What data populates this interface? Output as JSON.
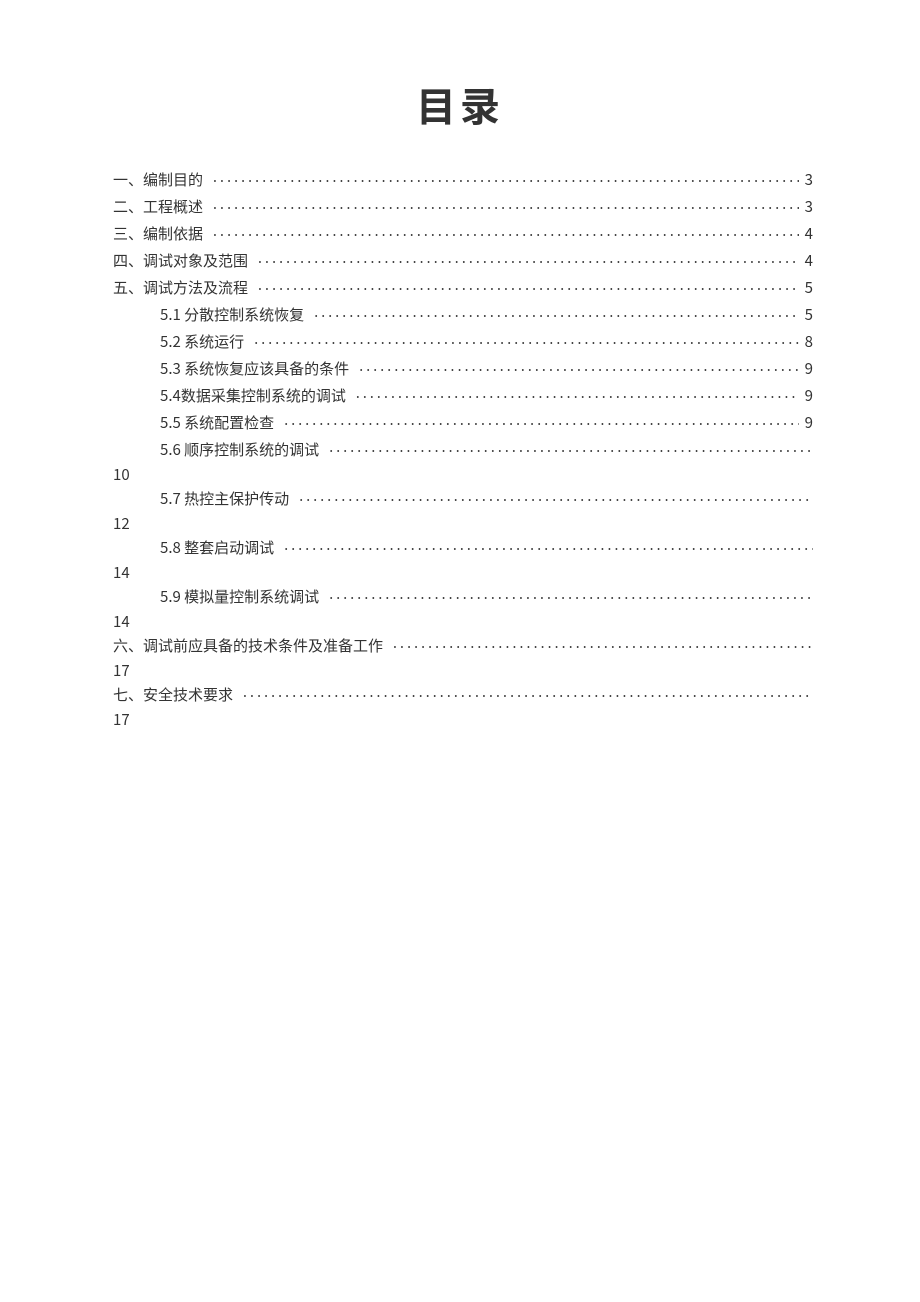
{
  "title": "目录",
  "toc": {
    "items": [
      {
        "label": "一、编制目的",
        "page": "3",
        "level": 0
      },
      {
        "label": "二、工程概述",
        "page": "3",
        "level": 0
      },
      {
        "label": "三、编制依据",
        "page": "4",
        "level": 0
      },
      {
        "label": "四、调试对象及范围",
        "page": "4",
        "level": 0
      },
      {
        "label": "五、调试方法及流程",
        "page": "5",
        "level": 0
      },
      {
        "label": "5.1 分散控制系统恢复",
        "page": "5",
        "level": 1
      },
      {
        "label": "5.2 系统运行",
        "page": "8",
        "level": 1
      },
      {
        "label": "5.3 系统恢复应该具备的条件",
        "page": "9",
        "level": 1
      },
      {
        "label": "5.4数据采集控制系统的调试",
        "page": "9",
        "level": 1
      },
      {
        "label": "5.5 系统配置检查",
        "page": "9",
        "level": 1
      },
      {
        "label": "5.6 顺序控制系统的调试",
        "page": "10",
        "level": 1,
        "wrap": true
      },
      {
        "label": "5.7 热控主保护传动",
        "page": "12",
        "level": 1,
        "wrap": true
      },
      {
        "label": "5.8 整套启动调试",
        "page": "14",
        "level": 1,
        "wrap": true
      },
      {
        "label": "5.9 模拟量控制系统调试",
        "page": "14",
        "level": 1,
        "wrap": true
      },
      {
        "label": "六、调试前应具备的技术条件及准备工作",
        "page": "17",
        "level": 0,
        "wrap": true
      },
      {
        "label": "七、安全技术要求",
        "page": "17",
        "level": 0,
        "wrap": true
      }
    ]
  }
}
